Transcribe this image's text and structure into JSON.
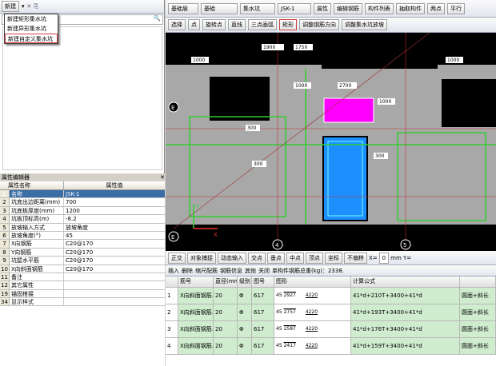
{
  "toolbar_left": {
    "new_label": "新建"
  },
  "new_menu": {
    "items": [
      "新建矩形集水坑",
      "新建异形集水坑",
      "新建自定义集水坑"
    ]
  },
  "top_toolbar": {
    "floor": "基础层",
    "category": "基础",
    "type": "集水坑",
    "component": "JSK-1",
    "buttons": [
      "属性",
      "编辑钢筋",
      "构件列表",
      "抽取构件",
      "两点",
      "平行"
    ]
  },
  "draw_toolbar": {
    "buttons": [
      "选择",
      "点",
      "旋转点",
      "直线",
      "三点画弧",
      "矩形",
      "调整钢筋方向",
      "调整集水坑放坡"
    ]
  },
  "props": {
    "title": "属性编辑器",
    "col_name": "属性名称",
    "col_value": "属性值",
    "rows": [
      {
        "n": "1",
        "label": "名称",
        "value": "JSK-1"
      },
      {
        "n": "2",
        "label": "坑底出边距离(mm)",
        "value": "700"
      },
      {
        "n": "3",
        "label": "坑底板厚度(mm)",
        "value": "1200"
      },
      {
        "n": "4",
        "label": "坑板顶标高(m)",
        "value": "-8.2"
      },
      {
        "n": "5",
        "label": "放坡输入方式",
        "value": "放坡角度"
      },
      {
        "n": "6",
        "label": "放坡角度(°)",
        "value": "45"
      },
      {
        "n": "7",
        "label": "X向钢筋",
        "value": "C20@170"
      },
      {
        "n": "8",
        "label": "Y向钢筋",
        "value": "C20@170"
      },
      {
        "n": "9",
        "label": "坑壁水平筋",
        "value": "C20@170"
      },
      {
        "n": "10",
        "label": "X向斜面钢筋",
        "value": "C20@170"
      },
      {
        "n": "11",
        "label": "备注",
        "value": ""
      },
      {
        "n": "12",
        "label": "其它属性",
        "value": ""
      },
      {
        "n": "19",
        "label": "锚固搭接",
        "value": ""
      },
      {
        "n": "34",
        "label": "显示样式",
        "value": ""
      }
    ]
  },
  "cad": {
    "dims": [
      "1900",
      "1750",
      "1000",
      "1000",
      "2700",
      "1000",
      "1000",
      "300",
      "300",
      "300"
    ],
    "axes": [
      "E",
      "E",
      "4",
      "5",
      "4"
    ],
    "axis_y": "Y",
    "axis_x": "X"
  },
  "snap_toolbar": {
    "items": [
      "正交",
      "对象捕捉",
      "动态输入",
      "交点",
      "垂点",
      "中点",
      "顶点",
      "坐标",
      "不偏移",
      "X=",
      "0",
      "mm Y="
    ]
  },
  "rebar_toolbar": {
    "items": [
      "插入",
      "删除",
      "缩尺配筋",
      "钢筋信息",
      "其他",
      "关闭",
      "单构件钢筋总重(kg)：2338."
    ]
  },
  "rebar_table": {
    "headers": [
      "",
      "筋号",
      "直径(mm)",
      "级别",
      "图号",
      "图形",
      "计算公式",
      ""
    ],
    "rows": [
      {
        "n": "1",
        "name": "X向斜面钢筋.1",
        "d": "20",
        "grade": "Φ",
        "fig": "617",
        "shape_a": "45",
        "shape_b": "2927",
        "shape_c": "4220",
        "formula": "41*d+210T+3400+41*d",
        "note": "圆面+斜长"
      },
      {
        "n": "2",
        "name": "X向斜面钢筋.2",
        "d": "20",
        "grade": "Φ",
        "fig": "617",
        "shape_a": "45",
        "shape_b": "2757",
        "shape_c": "4220",
        "formula": "41*d+193T+3400+41*d",
        "note": "圆面+斜长"
      },
      {
        "n": "3",
        "name": "X向斜面钢筋.3",
        "d": "20",
        "grade": "Φ",
        "fig": "617",
        "shape_a": "45",
        "shape_b": "2587",
        "shape_c": "4220",
        "formula": "41*d+176T+3400+41*d",
        "note": "圆面+斜长"
      },
      {
        "n": "4",
        "name": "X向斜面钢筋.4",
        "d": "20",
        "grade": "Φ",
        "fig": "617",
        "shape_a": "45",
        "shape_b": "2417",
        "shape_c": "4220",
        "formula": "41*d+159T+3400+41*d",
        "note": "圆面+斜长"
      }
    ]
  },
  "colors": {
    "cad_bg": "#000000",
    "cad_wall": "#a8a8a8",
    "highlight": "#ff00ff",
    "selected_pit": "#1e8fff",
    "rebar_row": "#cfeccf"
  }
}
